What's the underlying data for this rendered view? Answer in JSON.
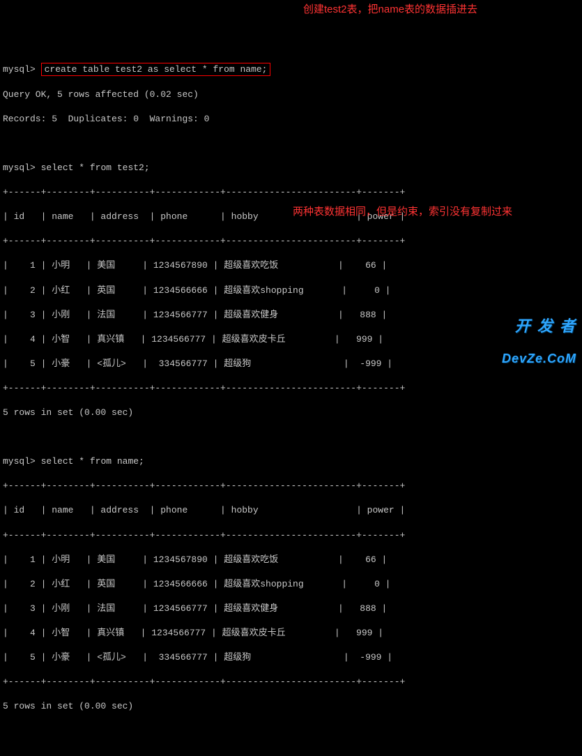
{
  "prompt": "mysql>",
  "commands": {
    "create": "create table test2 as select * from name;",
    "select_test2": "select * from test2;",
    "select_name": "select * from name;"
  },
  "responses": {
    "query_ok": "Query OK, 5 rows affected (0.02 sec)",
    "records_line": "Records: 5  Duplicates: 0  Warnings: 0",
    "rows_in_set": "5 rows in set (0.00 sec)"
  },
  "annotations": {
    "ann1": "创建test2表，把name表的数据插进去",
    "ann2": "两种表数据相同，但是约束，索引没有复制过来"
  },
  "table_sep": "+------+--------+----------+------------+------------------------+-------+",
  "table_head": "| id   | name   | address  | phone      | hobby                  | power |",
  "table_rows": [
    "|    1 | 小明   | 美国     | 1234567890 | 超级喜欢吃饭           |    66 |",
    "|    2 | 小红   | 英国     | 1234566666 | 超级喜欢shopping       |     0 |",
    "|    3 | 小刚   | 法国     | 1234566777 | 超级喜欢健身           |   888 |",
    "|    4 | 小智   | 真兴镇   | 1234566777 | 超级喜欢皮卡丘         |   999 |",
    "|    5 | 小豪   | <孤儿>   |  334566777 | 超级狗                 |  -999 |"
  ],
  "watermark": {
    "line1": "开 发 者",
    "line2": "DevZe.CoM"
  },
  "chart_data": {
    "type": "table",
    "columns": [
      "id",
      "name",
      "address",
      "phone",
      "hobby",
      "power"
    ],
    "rows": [
      {
        "id": 1,
        "name": "小明",
        "address": "美国",
        "phone": "1234567890",
        "hobby": "超级喜欢吃饭",
        "power": 66
      },
      {
        "id": 2,
        "name": "小红",
        "address": "英国",
        "phone": "1234566666",
        "hobby": "超级喜欢shopping",
        "power": 0
      },
      {
        "id": 3,
        "name": "小刚",
        "address": "法国",
        "phone": "1234566777",
        "hobby": "超级喜欢健身",
        "power": 888
      },
      {
        "id": 4,
        "name": "小智",
        "address": "真兴镇",
        "phone": "1234566777",
        "hobby": "超级喜欢皮卡丘",
        "power": 999
      },
      {
        "id": 5,
        "name": "小豪",
        "address": "<孤儿>",
        "phone": "334566777",
        "hobby": "超级狗",
        "power": -999
      }
    ]
  }
}
